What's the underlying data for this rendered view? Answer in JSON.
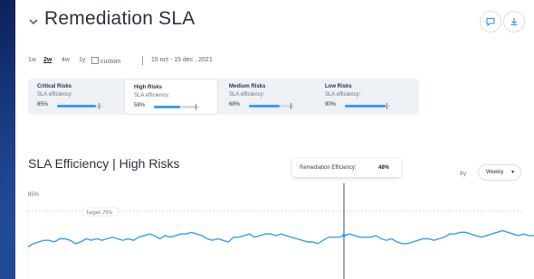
{
  "header": {
    "title": "Remediation SLA",
    "comment_icon": "comment-icon",
    "download_icon": "download-icon"
  },
  "filters": {
    "ranges": [
      "1w",
      "2w",
      "4w",
      "1y"
    ],
    "active_range": "2w",
    "custom_label": "custom",
    "date_range": "15 oct - 15 dec , 2021"
  },
  "cards": [
    {
      "title": "Critical Risks",
      "sub": "SLA efficiency:",
      "value": "85%",
      "fill": 0.85
    },
    {
      "title": "High Risks",
      "sub": "SLA efficiency:",
      "value": "58%",
      "fill": 0.58
    },
    {
      "title": "Medium Risks",
      "sub": "SLA efficiency:",
      "value": "68%",
      "fill": 0.68
    },
    {
      "title": "Low Risks",
      "sub": "SLA efficiency:",
      "value": "90%",
      "fill": 0.9
    }
  ],
  "chart": {
    "title": "SLA Efficiency  |  High Risks",
    "tooltip_label": "Remediation Efficiency:",
    "tooltip_value": "48%",
    "by_label": "By:",
    "period": "Weekly",
    "y_tick": "85%",
    "target_label": "Target: 75%"
  },
  "chart_data": {
    "type": "line",
    "title": "SLA Efficiency | High Risks",
    "ylabel": "",
    "xlabel": "",
    "target": 75,
    "series": [
      {
        "values": [
          50,
          52,
          53,
          54,
          54,
          53,
          55,
          55,
          54,
          52,
          53,
          55,
          54,
          55,
          54,
          55,
          56,
          55,
          54,
          55,
          54,
          56,
          57,
          58,
          57,
          55,
          57,
          56,
          57,
          58,
          58,
          59,
          58,
          57,
          55,
          54,
          55,
          54,
          53,
          56,
          56,
          57,
          58,
          56,
          57,
          58,
          58,
          57,
          58,
          57,
          56,
          55,
          54,
          53,
          53,
          52,
          54,
          56,
          56,
          56,
          57,
          58,
          57,
          56,
          56,
          56,
          57,
          55,
          54,
          55,
          53,
          52,
          52,
          53,
          54,
          55,
          55,
          54,
          55,
          56,
          58,
          58,
          59,
          59,
          58,
          57,
          56,
          57,
          58,
          59,
          60,
          59,
          58,
          57,
          58,
          57,
          57
        ]
      }
    ]
  }
}
